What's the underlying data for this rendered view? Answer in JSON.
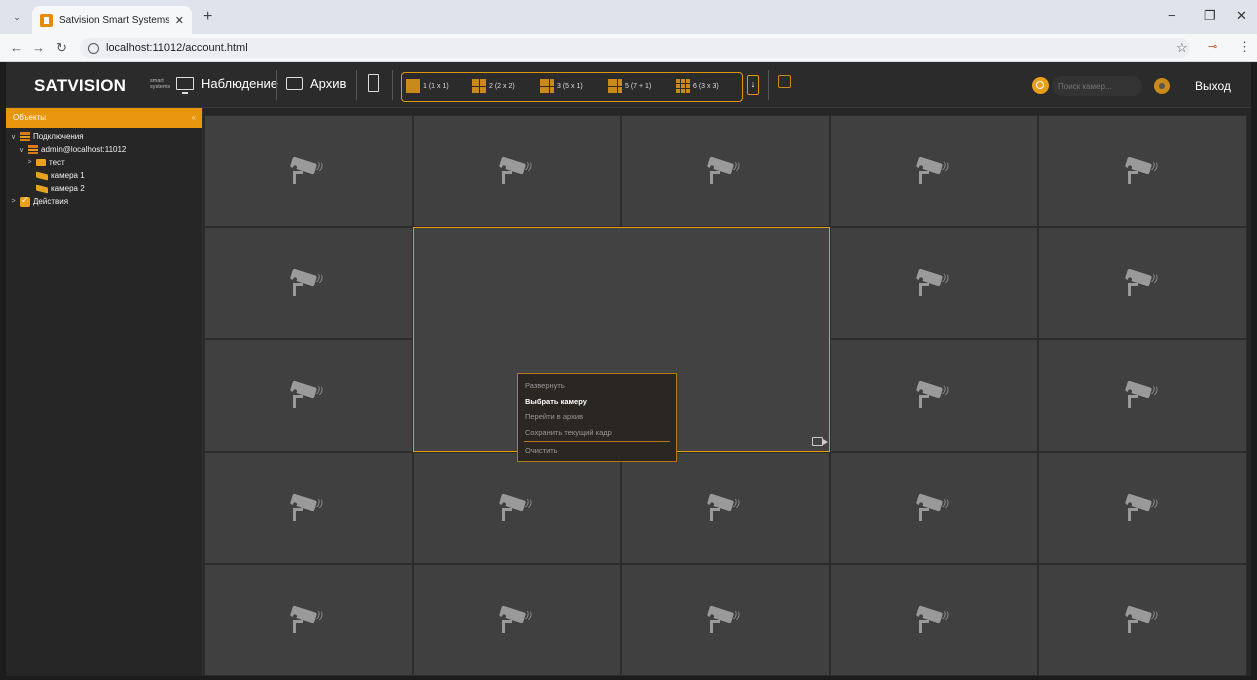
{
  "browser": {
    "tab_title": "Satvision Smart Systems: Набл",
    "tab_close": "✕",
    "new_tab": "+",
    "url": "localhost:11012/account.html",
    "window_controls": {
      "minimize": "−",
      "restore": "❐",
      "close": "✕"
    }
  },
  "header": {
    "logo": "SATVISION",
    "logo_sub": "smart systems",
    "nav": {
      "watch": "Наблюдение",
      "archive": "Архив"
    },
    "layouts": [
      {
        "label": "1 (1 x 1)",
        "grid": 1
      },
      {
        "label": "2 (2 x 2)",
        "grid": 2
      },
      {
        "label": "3 (5 x 1)",
        "grid": 3
      },
      {
        "label": "5 (7 + 1)",
        "grid": 5
      },
      {
        "label": "6 (3 x 3)",
        "grid": 6
      }
    ],
    "layout_more": "↓",
    "search_placeholder": "Поиск камер...",
    "logout": "Выход"
  },
  "sidebar": {
    "title": "Объекты",
    "collapse": "«",
    "tree": [
      {
        "label": "Подключения",
        "icon": "server",
        "level": 0,
        "chevron": "∨"
      },
      {
        "label": "admin@localhost:11012",
        "icon": "server",
        "level": 1,
        "chevron": "∨"
      },
      {
        "label": "тест",
        "icon": "folder",
        "level": 2,
        "chevron": ">"
      },
      {
        "label": "камера 1",
        "icon": "camera",
        "level": 2,
        "chevron": ""
      },
      {
        "label": "камера 2",
        "icon": "camera",
        "level": 2,
        "chevron": ""
      },
      {
        "label": "Действия",
        "icon": "check",
        "level": 0,
        "chevron": ">"
      }
    ]
  },
  "context_menu": {
    "items": [
      {
        "label": "Развернуть",
        "active": false
      },
      {
        "label": "Выбрать камеру",
        "active": true
      },
      {
        "label": "Перейти в архив",
        "active": false
      },
      {
        "label": "Сохранить текущий кадр",
        "active": false
      },
      {
        "label": "Очистить",
        "active": false,
        "divider_before": true
      }
    ]
  }
}
